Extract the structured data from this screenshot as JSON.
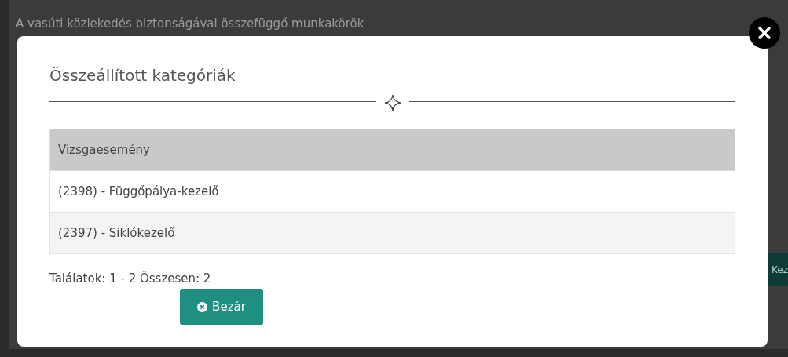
{
  "background_page": {
    "title": "A vasúti közlekedés biztonságával összefüggő munkakörök",
    "side_button": "Kez"
  },
  "modal": {
    "title": "Összeállított kategóriák",
    "table": {
      "columns": [
        "Vizsgaesemény"
      ],
      "rows": [
        [
          "(2398) - Függőpálya-kezelő"
        ],
        [
          "(2397) - Siklókezelő"
        ]
      ]
    },
    "summary": "Találatok: 1 - 2 Összesen: 2",
    "close_button": "Bezár"
  }
}
